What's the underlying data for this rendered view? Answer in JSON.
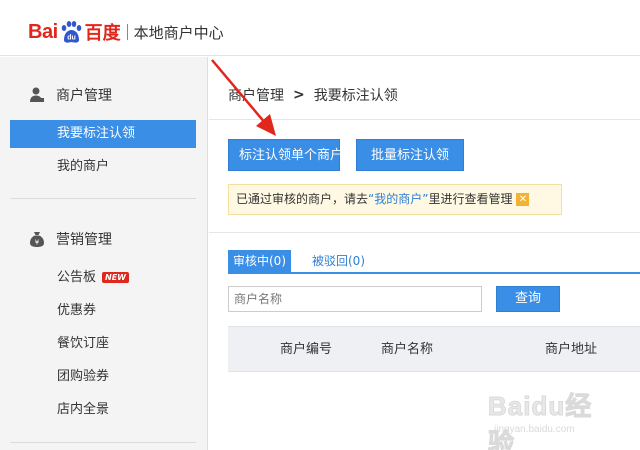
{
  "header": {
    "logo_bai": "Bai",
    "logo_du": "du",
    "logo_cn": "百度",
    "subtitle": "本地商户中心"
  },
  "sidebar": {
    "groups": [
      {
        "title": "商户管理",
        "icon": "user-icon",
        "items": [
          {
            "label": "我要标注认领",
            "active": true
          },
          {
            "label": "我的商户",
            "active": false
          }
        ]
      },
      {
        "title": "营销管理",
        "icon": "money-bag-icon",
        "items": [
          {
            "label": "公告板",
            "badge": "NEW"
          },
          {
            "label": "优惠券"
          },
          {
            "label": "餐饮订座"
          },
          {
            "label": "团购验券"
          },
          {
            "label": "店内全景"
          }
        ]
      }
    ]
  },
  "breadcrumb": {
    "parent": "商户管理",
    "separator": ">",
    "current": "我要标注认领"
  },
  "actions": {
    "single_label": "标注认领单个商户",
    "batch_label": "批量标注认领"
  },
  "notice": {
    "prefix": "已通过审核的商户，请去",
    "link": "“我的商户”",
    "suffix": "里进行查看管理",
    "close": "✕"
  },
  "tabs": [
    {
      "label": "审核中(0)",
      "active": true
    },
    {
      "label": "被驳回(0)",
      "active": false
    }
  ],
  "search": {
    "placeholder": "商户名称",
    "button_label": "查询"
  },
  "table": {
    "columns": [
      "商户编号",
      "商户名称",
      "商户地址"
    ]
  },
  "watermark": {
    "text": "Baidu经验",
    "url": "jingyan.baidu.com"
  },
  "colors": {
    "accent": "#3a8ee6",
    "brand_red": "#e1261c",
    "notice_bg": "#fff9e3"
  }
}
